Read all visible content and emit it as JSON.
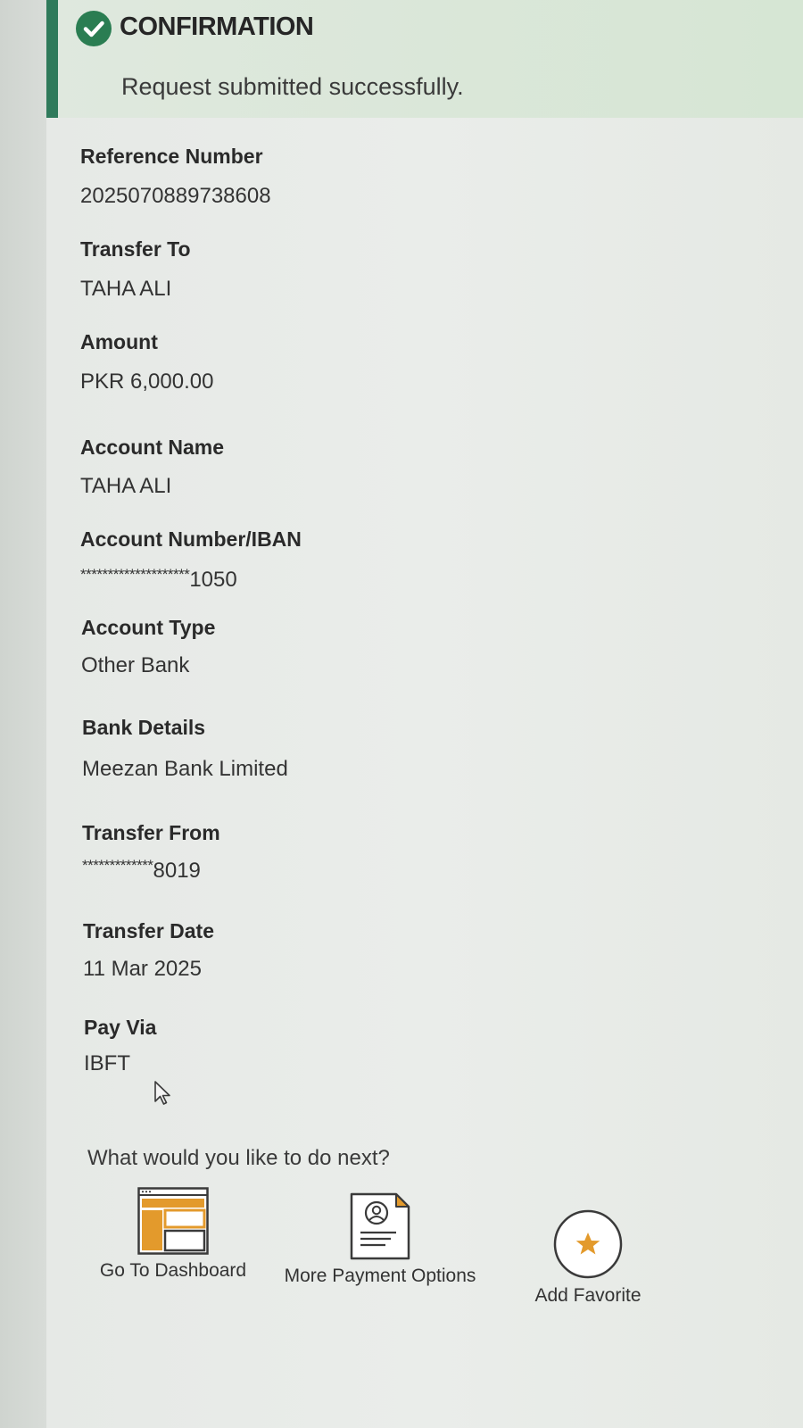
{
  "banner": {
    "title": "CONFIRMATION",
    "message": "Request submitted successfully.",
    "icon": "check-circle-icon",
    "icon_color": "#2a7d52",
    "accent_color": "#2f7a5b"
  },
  "details": [
    {
      "label": "Reference Number",
      "value": "2025070889738608"
    },
    {
      "label": "Transfer To",
      "value": "TAHA ALI"
    },
    {
      "label": "Amount",
      "value": "PKR 6,000.00"
    },
    {
      "label": "Account Name",
      "value": "TAHA ALI"
    },
    {
      "label": "Account Number/IBAN",
      "mask": "********************",
      "value": "1050"
    },
    {
      "label": "Account Type",
      "value": "Other Bank"
    },
    {
      "label": "Bank Details",
      "value": "Meezan Bank Limited"
    },
    {
      "label": "Transfer From",
      "mask": "*************",
      "value": "8019"
    },
    {
      "label": "Transfer Date",
      "value": "11 Mar 2025"
    },
    {
      "label": "Pay Via",
      "value": "IBFT"
    }
  ],
  "next": {
    "title": "What would you like to do next?",
    "actions": [
      {
        "label": "Go To Dashboard",
        "icon": "dashboard-icon"
      },
      {
        "label": "More Payment Options",
        "icon": "payment-document-icon"
      },
      {
        "label": "Add Favorite",
        "icon": "star-icon"
      }
    ]
  },
  "colors": {
    "orange_accent": "#e39a2c",
    "text_dark": "#2a2a2a"
  }
}
